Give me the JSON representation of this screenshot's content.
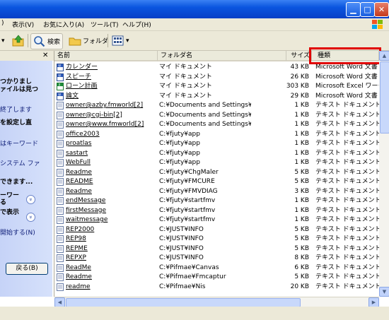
{
  "menubar": {
    "items": [
      "表示(V)",
      "お気に入り(A)",
      "ツール(T)",
      "ヘルプ(H)"
    ]
  },
  "toolbar": {
    "search_label": "検索",
    "folders_label": "フォルダ"
  },
  "left_pane": {
    "lines": [
      {
        "text": "つかりまし",
        "bold": true
      },
      {
        "text": "ァイルは見つ",
        "bold": true
      },
      {
        "text": "終了します",
        "bold": false
      },
      {
        "text": "を設定し直",
        "bold": true
      },
      {
        "text": "はキーワード",
        "bold": false
      },
      {
        "text": "システム ファ",
        "bold": false
      },
      {
        "text": "できます...",
        "bold": true
      },
      {
        "text": "ーワー",
        "bold": true
      },
      {
        "text": "る",
        "bold": true
      },
      {
        "text": "で表示",
        "bold": true
      },
      {
        "text": "開始する(N)",
        "bold": false
      }
    ],
    "back_button": "戻る(B)"
  },
  "list": {
    "columns": {
      "name": "名前",
      "folder": "フォルダ名",
      "size": "サイズ",
      "type": "種類"
    },
    "rows": [
      {
        "name": "カレンダー",
        "folder": "マイ ドキュメント",
        "size": "43 KB",
        "type": "Microsoft Word 文書",
        "icon": "word"
      },
      {
        "name": "スピーチ",
        "folder": "マイ ドキュメント",
        "size": "26 KB",
        "type": "Microsoft Word 文書",
        "icon": "word"
      },
      {
        "name": "ローン計画",
        "folder": "マイ ドキュメント",
        "size": "303 KB",
        "type": "Microsoft Excel ワーク",
        "icon": "excel"
      },
      {
        "name": "論文",
        "folder": "マイ ドキュメント",
        "size": "29 KB",
        "type": "Microsoft Word 文書",
        "icon": "word"
      },
      {
        "name": "owner@azby.fmworld[2]",
        "folder": "C:¥Documents and Settings¥O...",
        "size": "1 KB",
        "type": "テキスト ドキュメント",
        "icon": "text"
      },
      {
        "name": "owner@cgi-bin[2]",
        "folder": "C:¥Documents and Settings¥O...",
        "size": "1 KB",
        "type": "テキスト ドキュメント",
        "icon": "text"
      },
      {
        "name": "owner@www.fmworld[2]",
        "folder": "C:¥Documents and Settings¥O...",
        "size": "1 KB",
        "type": "テキスト ドキュメント",
        "icon": "text"
      },
      {
        "name": "office2003",
        "folder": "C:¥fjuty¥app",
        "size": "1 KB",
        "type": "テキスト ドキュメント",
        "icon": "text"
      },
      {
        "name": "proatlas",
        "folder": "C:¥fjuty¥app",
        "size": "1 KB",
        "type": "テキスト ドキュメント",
        "icon": "text"
      },
      {
        "name": "sastart",
        "folder": "C:¥fjuty¥app",
        "size": "1 KB",
        "type": "テキスト ドキュメント",
        "icon": "text"
      },
      {
        "name": "WebFull",
        "folder": "C:¥fjuty¥app",
        "size": "1 KB",
        "type": "テキスト ドキュメント",
        "icon": "text"
      },
      {
        "name": "Readme",
        "folder": "C:¥fjuty¥ChgMaler",
        "size": "5 KB",
        "type": "テキスト ドキュメント",
        "icon": "text"
      },
      {
        "name": "README",
        "folder": "C:¥fjuty¥FMCURE",
        "size": "5 KB",
        "type": "テキスト ドキュメント",
        "icon": "text"
      },
      {
        "name": "Readme",
        "folder": "C:¥fjuty¥FMVDIAG",
        "size": "3 KB",
        "type": "テキスト ドキュメント",
        "icon": "text"
      },
      {
        "name": "endMessage",
        "folder": "C:¥fjuty¥startfmv",
        "size": "1 KB",
        "type": "テキスト ドキュメント",
        "icon": "text"
      },
      {
        "name": "firstMessage",
        "folder": "C:¥fjuty¥startfmv",
        "size": "1 KB",
        "type": "テキスト ドキュメント",
        "icon": "text"
      },
      {
        "name": "waitmessage",
        "folder": "C:¥fjuty¥startfmv",
        "size": "1 KB",
        "type": "テキスト ドキュメント",
        "icon": "text"
      },
      {
        "name": "REP2000",
        "folder": "C:¥JUST¥INFO",
        "size": "5 KB",
        "type": "テキスト ドキュメント",
        "icon": "text"
      },
      {
        "name": "REP98",
        "folder": "C:¥JUST¥INFO",
        "size": "5 KB",
        "type": "テキスト ドキュメント",
        "icon": "text"
      },
      {
        "name": "REPME",
        "folder": "C:¥JUST¥INFO",
        "size": "5 KB",
        "type": "テキスト ドキュメント",
        "icon": "text"
      },
      {
        "name": "REPXP",
        "folder": "C:¥JUST¥INFO",
        "size": "8 KB",
        "type": "テキスト ドキュメント",
        "icon": "text"
      },
      {
        "name": "ReadMe",
        "folder": "C:¥Pifmae¥Canvas",
        "size": "6 KB",
        "type": "テキスト ドキュメント",
        "icon": "text"
      },
      {
        "name": "Readme",
        "folder": "C:¥Pifmae¥Fmcaptur",
        "size": "5 KB",
        "type": "テキスト ドキュメント",
        "icon": "text"
      },
      {
        "name": "readme",
        "folder": "C:¥Pifmae¥Nis",
        "size": "20 KB",
        "type": "テキスト ドキュメント",
        "icon": "text"
      }
    ]
  },
  "colors": {
    "highlight": "#e00000",
    "title_bar": "#0a55df"
  }
}
